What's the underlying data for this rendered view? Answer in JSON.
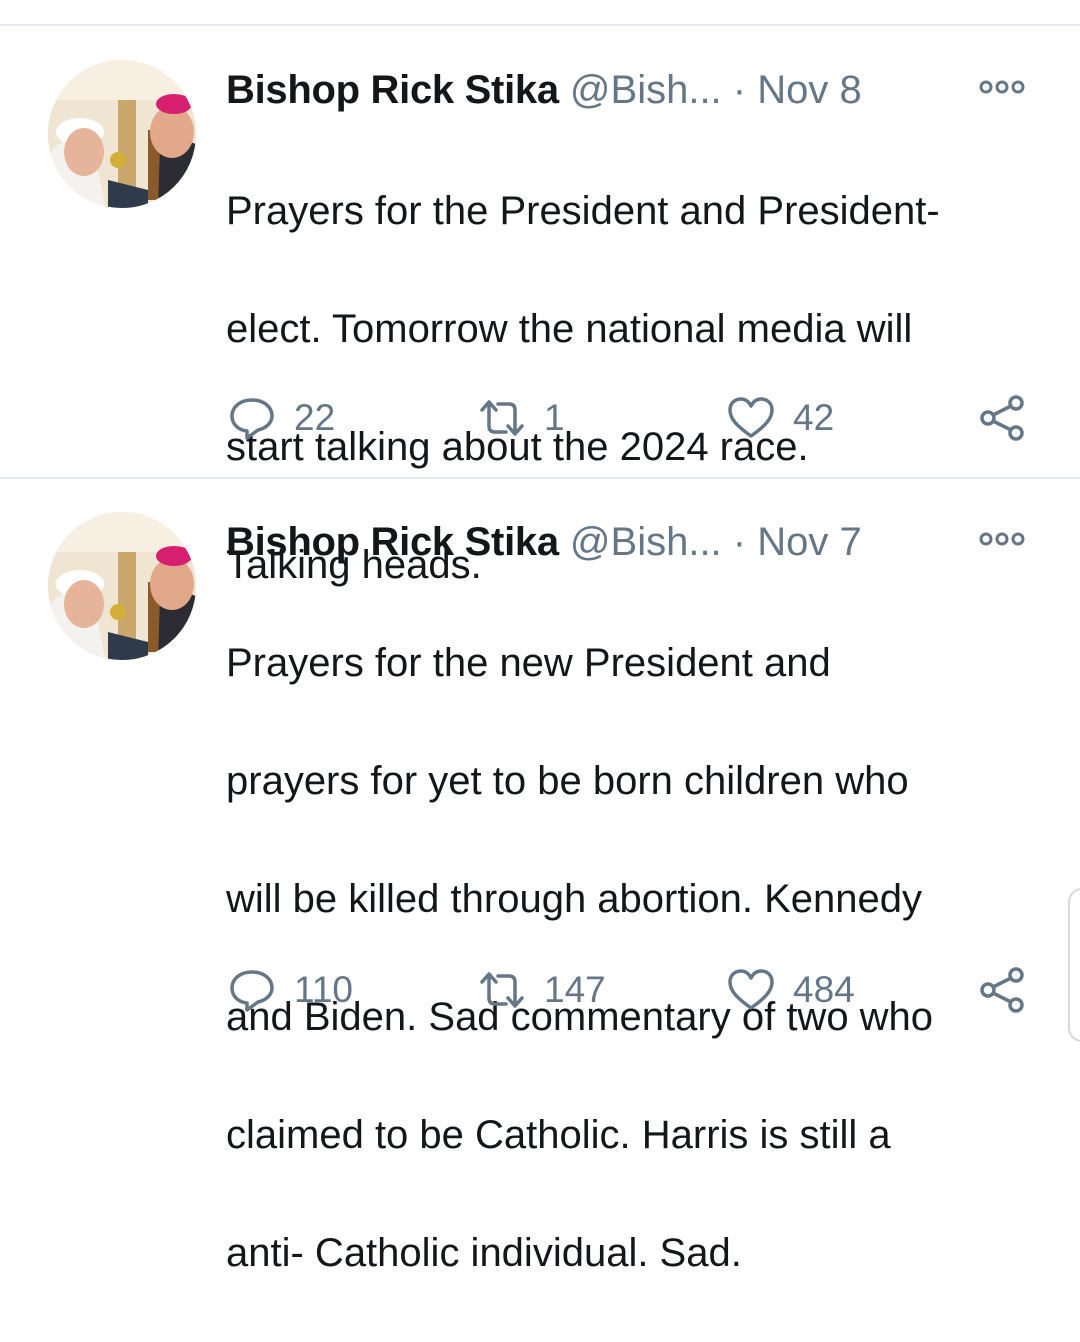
{
  "tweets": [
    {
      "display_name": "Bishop Rick Stika",
      "handle": "@Bish...",
      "separator": "·",
      "date": "Nov 8",
      "text_lines": [
        "Prayers for the President and President-",
        "elect. Tomorrow  the national media will",
        "start talking about the 2024 race.",
        "Talking heads."
      ],
      "replies": "22",
      "retweets": "1",
      "likes": "42"
    },
    {
      "display_name": "Bishop Rick Stika",
      "handle": "@Bish...",
      "separator": "·",
      "date": "Nov 7",
      "text_lines": [
        "Prayers for  the new President and",
        "prayers for yet to be born children who",
        "will be killed through abortion. Kennedy",
        "and Biden. Sad commentary of two who",
        "claimed to be Catholic. Harris is still a",
        "anti- Catholic individual. Sad."
      ],
      "replies": "110",
      "retweets": "147",
      "likes": "484"
    }
  ],
  "icons": {
    "reply": "reply-icon",
    "retweet": "retweet-icon",
    "like": "heart-icon",
    "share": "share-icon",
    "more": "more-options-icon"
  },
  "colors": {
    "text_primary": "#14171a",
    "text_secondary": "#657786",
    "divider": "#e6ecf0"
  }
}
